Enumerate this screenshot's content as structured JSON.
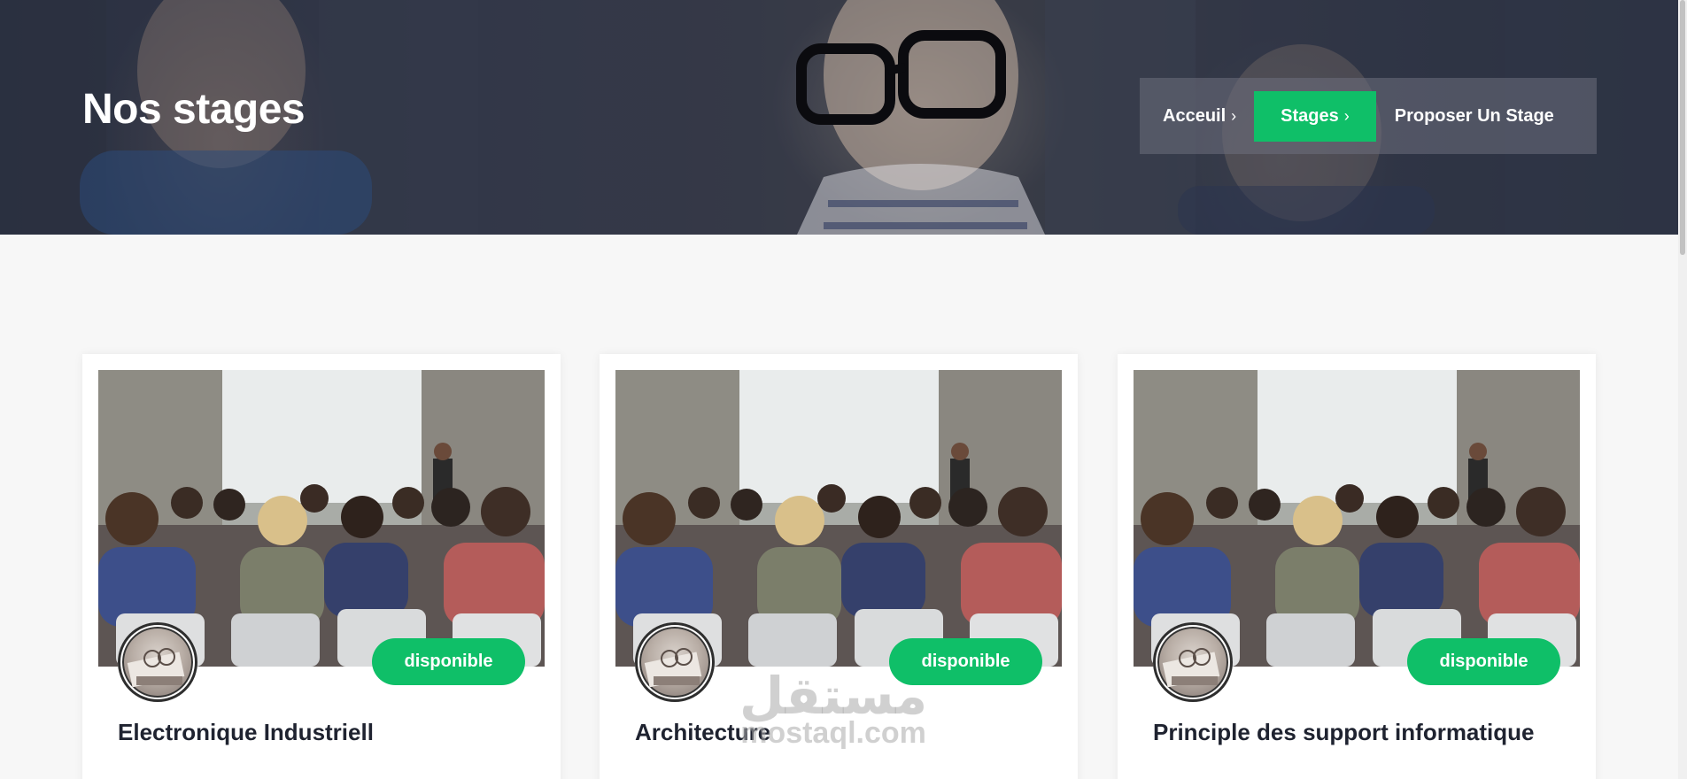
{
  "hero": {
    "title": "Nos stages"
  },
  "breadcrumb": {
    "items": [
      {
        "label": "Acceuil",
        "active": false
      },
      {
        "label": "Stages",
        "active": true
      },
      {
        "label": "Proposer Un Stage",
        "active": false
      }
    ],
    "separator": "›"
  },
  "cards": [
    {
      "title": "Electronique Industriell",
      "badge": "disponible"
    },
    {
      "title": "Architecture",
      "badge": "disponible"
    },
    {
      "title": "Principle des support informatique",
      "badge": "disponible"
    }
  ],
  "watermark": {
    "arabic": "مستقل",
    "latin": "mostaql.com"
  },
  "colors": {
    "accent": "#0fbf68",
    "title_text": "#1f2330",
    "page_bg": "#f7f7f7"
  }
}
